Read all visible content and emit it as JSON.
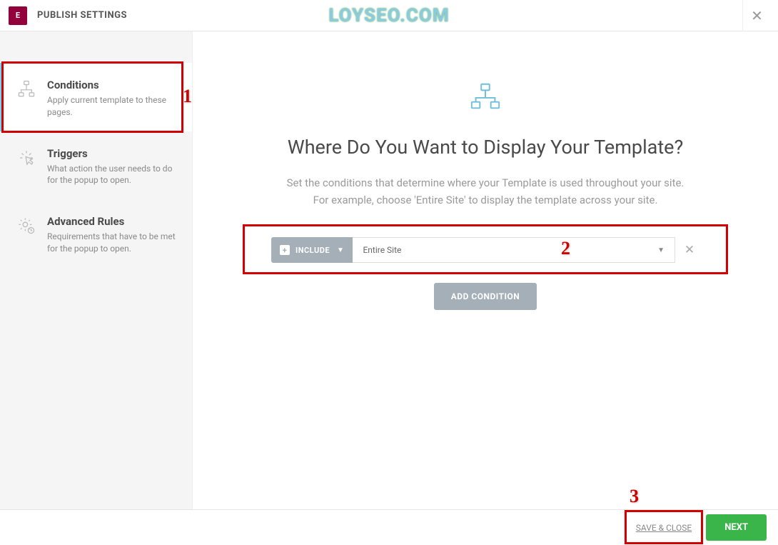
{
  "header": {
    "logo_text": "E",
    "title": "PUBLISH SETTINGS",
    "watermark": "LOYSEO.COM"
  },
  "sidebar": {
    "items": [
      {
        "title": "Conditions",
        "desc": "Apply current template to these pages."
      },
      {
        "title": "Triggers",
        "desc": "What action the user needs to do for the popup to open."
      },
      {
        "title": "Advanced Rules",
        "desc": "Requirements that have to be met for the popup to open."
      }
    ]
  },
  "main": {
    "heading": "Where Do You Want to Display Your Template?",
    "sub1": "Set the conditions that determine where your Template is used throughout your site.",
    "sub2": "For example, choose 'Entire Site' to display the template across your site.",
    "condition": {
      "mode": "INCLUDE",
      "value": "Entire Site"
    },
    "add_btn": "ADD CONDITION"
  },
  "footer": {
    "save": "SAVE & CLOSE",
    "next": "NEXT"
  },
  "annotations": {
    "n1": "1",
    "n2": "2",
    "n3": "3"
  }
}
